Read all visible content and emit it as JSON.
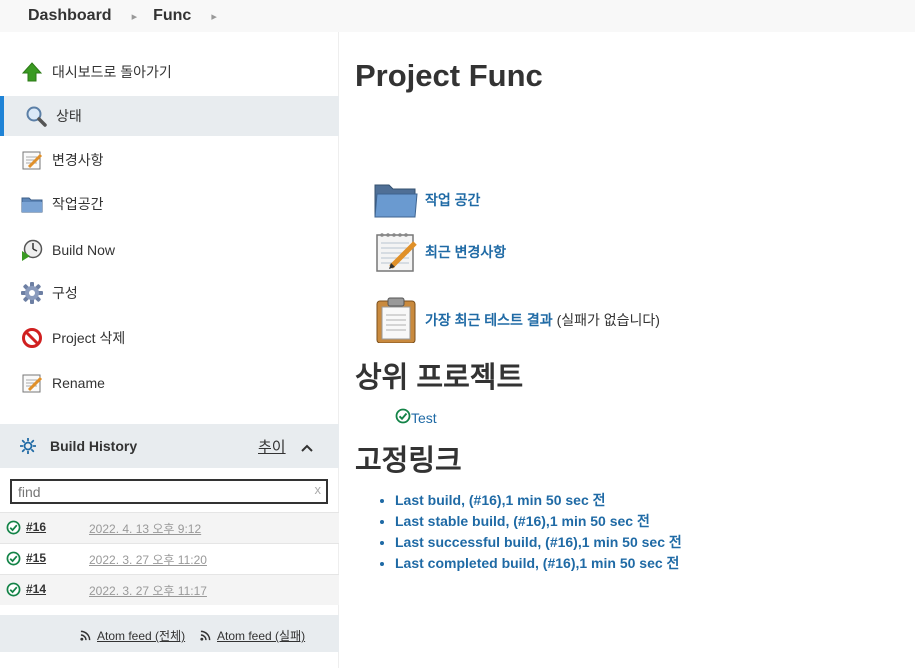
{
  "breadcrumb": {
    "items": [
      "Dashboard",
      "Func"
    ]
  },
  "tasks": [
    {
      "label": "대시보드로 돌아가기",
      "icon": "up-arrow-icon"
    },
    {
      "label": "상태",
      "icon": "search-icon"
    },
    {
      "label": "변경사항",
      "icon": "notepad-icon"
    },
    {
      "label": "작업공간",
      "icon": "folder-icon"
    },
    {
      "label": "Build Now",
      "icon": "clock-icon"
    },
    {
      "label": "구성",
      "icon": "gear-icon"
    },
    {
      "label": "Project 삭제",
      "icon": "no-entry-icon"
    },
    {
      "label": "Rename",
      "icon": "notepad-icon"
    }
  ],
  "build_history": {
    "title": "Build History",
    "trend_label": "추이",
    "search_placeholder": "find",
    "clear_glyph": "x",
    "builds": [
      {
        "number": "#16",
        "date": "2022. 4. 13 오후 9:12"
      },
      {
        "number": "#15",
        "date": "2022. 3. 27 오후 11:20"
      },
      {
        "number": "#14",
        "date": "2022. 3. 27 오후 11:17"
      }
    ],
    "feeds": [
      "Atom feed (전체)",
      "Atom feed (실패)"
    ]
  },
  "main": {
    "title": "Project Func",
    "links": [
      {
        "label": "작업 공간",
        "note": "",
        "icon": "folder-icon"
      },
      {
        "label": "최근 변경사항",
        "note": "",
        "icon": "notepad-icon"
      },
      {
        "label": "가장 최근 테스트 결과",
        "note": "(실패가 없습니다)",
        "icon": "clipboard-icon"
      }
    ],
    "upstream_heading": "상위 프로젝트",
    "upstream_projects": [
      "Test"
    ],
    "permalinks_heading": "고정링크",
    "permalinks": [
      "Last build, (#16),1 min 50 sec 전",
      "Last stable build, (#16),1 min 50 sec 전",
      "Last successful build, (#16),1 min 50 sec 전",
      "Last completed build, (#16),1 min 50 sec 전"
    ]
  },
  "colors": {
    "link": "#1f6aa5",
    "accent": "#1f83d6",
    "success": "#138347",
    "panel": "#e8ecef"
  }
}
